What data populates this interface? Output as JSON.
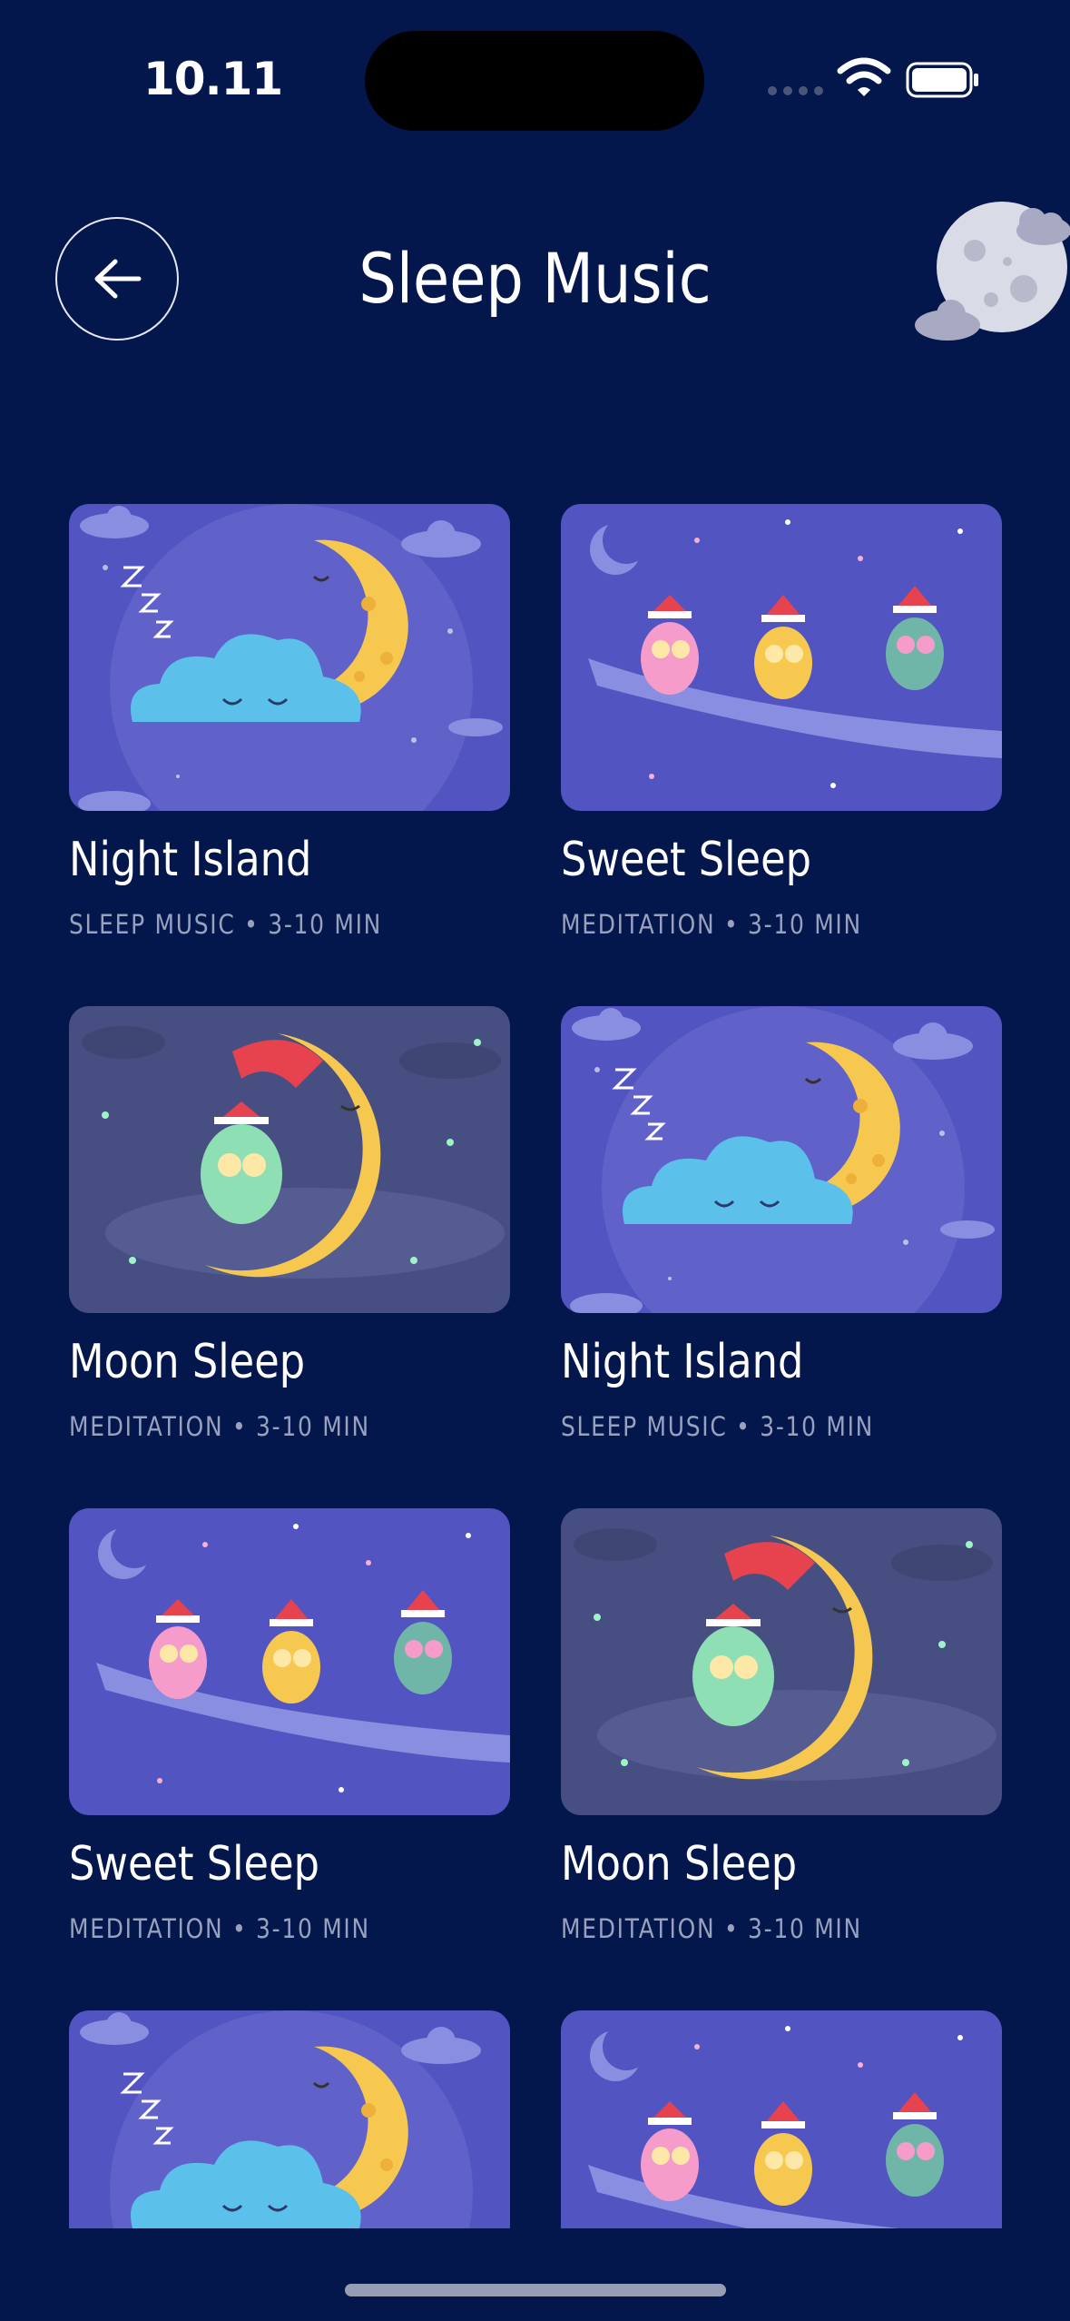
{
  "status_bar": {
    "time": "10.11"
  },
  "header": {
    "title": "Sleep Music"
  },
  "icons": {
    "back": "arrow-left-icon",
    "decoration": "moon-cloud-icon",
    "wifi": "wifi-icon",
    "battery": "battery-icon"
  },
  "colors": {
    "background": "#03174C",
    "card_purple": "#5254C1",
    "card_slate": "#474F82",
    "subtitle": "#98A1BD"
  },
  "cards": [
    {
      "title": "Night Island",
      "subtitle": "SLEEP MUSIC • 3-10 MIN",
      "art": "night-island"
    },
    {
      "title": "Sweet Sleep",
      "subtitle": "MEDITATION • 3-10 MIN",
      "art": "sweet-sleep"
    },
    {
      "title": "Moon Sleep",
      "subtitle": "MEDITATION • 3-10 MIN",
      "art": "moon-sleep"
    },
    {
      "title": "Night Island",
      "subtitle": "SLEEP MUSIC • 3-10 MIN",
      "art": "night-island"
    },
    {
      "title": "Sweet Sleep",
      "subtitle": "MEDITATION • 3-10 MIN",
      "art": "sweet-sleep"
    },
    {
      "title": "Moon Sleep",
      "subtitle": "MEDITATION • 3-10 MIN",
      "art": "moon-sleep"
    },
    {
      "title": "",
      "subtitle": "",
      "art": "night-island"
    },
    {
      "title": "",
      "subtitle": "",
      "art": "sweet-sleep"
    }
  ]
}
